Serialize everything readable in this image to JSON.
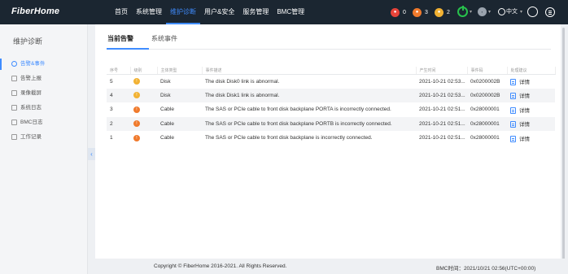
{
  "header": {
    "logo": "FiberHome",
    "nav": [
      {
        "label": "首页"
      },
      {
        "label": "系统管理"
      },
      {
        "label": "维护诊断"
      },
      {
        "label": "用户&安全"
      },
      {
        "label": "服务管理"
      },
      {
        "label": "BMC管理"
      }
    ],
    "active_nav": "维护诊断",
    "alerts": [
      {
        "severity": "critical",
        "count": "0",
        "color": "#e8443a"
      },
      {
        "severity": "major",
        "count": "3",
        "color": "#f07a2c"
      },
      {
        "severity": "minor",
        "count": "2",
        "color": "#f2b233"
      }
    ],
    "power_status_color": "#27c24c",
    "language": "中文"
  },
  "sidebar": {
    "title": "维护诊断",
    "items": [
      {
        "label": "告警&事件",
        "icon": "alarm-icon",
        "active": true
      },
      {
        "label": "告警上报",
        "icon": "report-icon"
      },
      {
        "label": "录像截屏",
        "icon": "video-icon"
      },
      {
        "label": "系统日志",
        "icon": "log-icon"
      },
      {
        "label": "BMC日志",
        "icon": "bmc-log-icon"
      },
      {
        "label": "工作记录",
        "icon": "record-icon"
      }
    ]
  },
  "tabs": [
    {
      "label": "当前告警",
      "active": true
    },
    {
      "label": "系统事件"
    }
  ],
  "table": {
    "columns": [
      "序号",
      "级别",
      "主体类型",
      "事件描述",
      "产生时间",
      "事件码",
      "处理建议"
    ],
    "rows": [
      {
        "no": "5",
        "severity": "minor",
        "severity_color": "#f2b233",
        "type": "Disk",
        "desc": "The disk Disk0 link is abnormal.",
        "time": "2021-10-21 02:53...",
        "code": "0x0200002B",
        "action": "详情"
      },
      {
        "no": "4",
        "severity": "minor",
        "severity_color": "#f2b233",
        "type": "Disk",
        "desc": "The disk Disk1 link is abnormal.",
        "time": "2021-10-21 02:53...",
        "code": "0x0200002B",
        "action": "详情"
      },
      {
        "no": "3",
        "severity": "major",
        "severity_color": "#f07a2c",
        "type": "Cable",
        "desc": "The SAS or PCIe cable to front disk backplane PORTA is incorrectly connected.",
        "time": "2021-10-21 02:51...",
        "code": "0x28000001",
        "action": "详情"
      },
      {
        "no": "2",
        "severity": "major",
        "severity_color": "#f07a2c",
        "type": "Cable",
        "desc": "The SAS or PCIe cable to front disk backplane PORTB is incorrectly connected.",
        "time": "2021-10-21 02:51...",
        "code": "0x28000001",
        "action": "详情"
      },
      {
        "no": "1",
        "severity": "major",
        "severity_color": "#f07a2c",
        "type": "Cable",
        "desc": "The SAS or PCIe cable to front disk backplane is incorrectly connected.",
        "time": "2021-10-21 02:51...",
        "code": "0x28000001",
        "action": "详情"
      }
    ]
  },
  "footer": {
    "copyright": "Copyright © FiberHome 2016-2021. All Rights Reserved.",
    "bmc_time": "BMC时间：2021/10/21 02:56(UTC+00:00)"
  }
}
